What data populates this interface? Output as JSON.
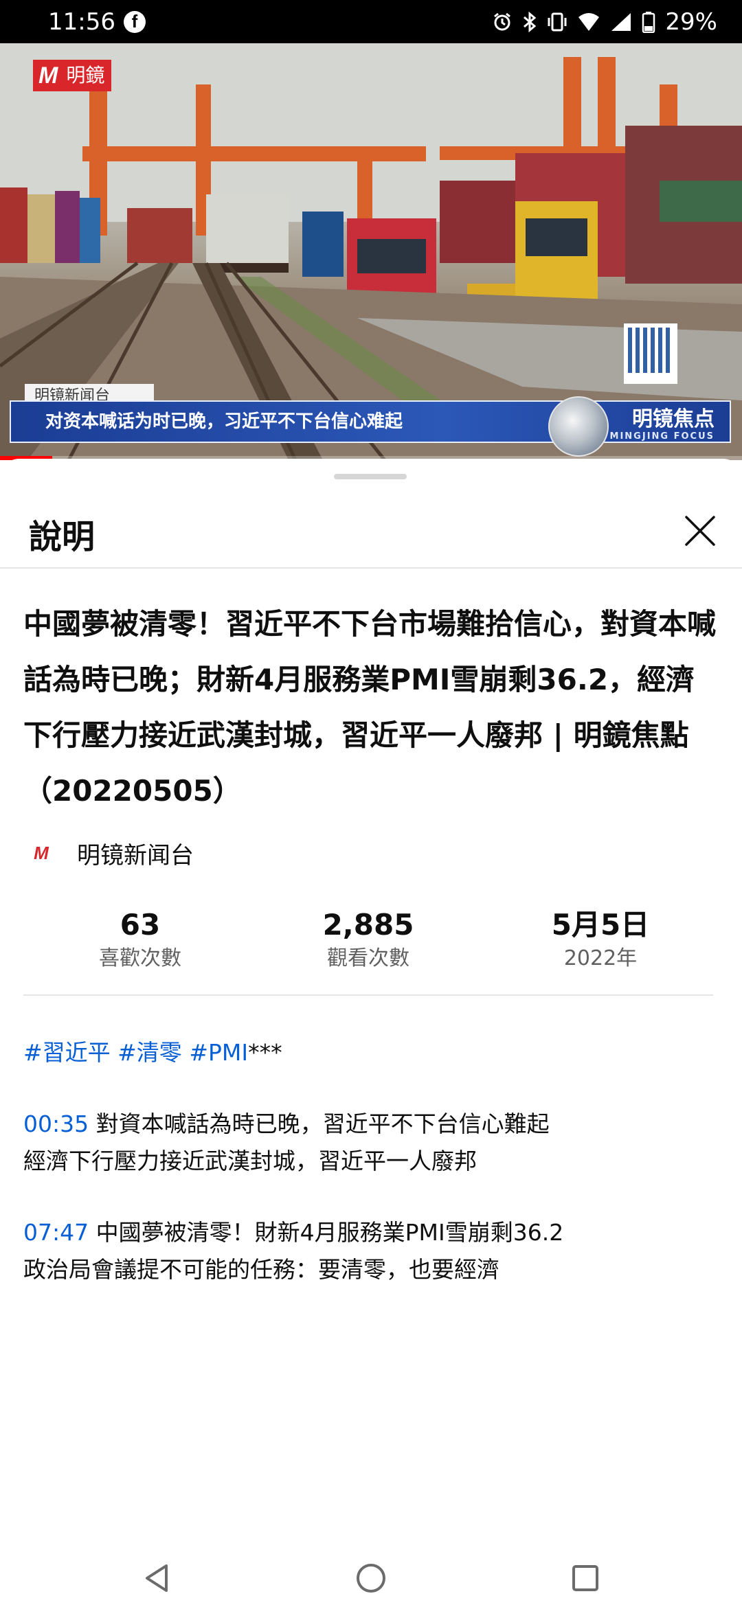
{
  "status_bar": {
    "time": "11:56",
    "notification_icon": "facebook-icon",
    "battery_percent": "29%",
    "icons": [
      "alarm-icon",
      "bluetooth-icon",
      "vibrate-icon",
      "wifi-icon",
      "signal-icon",
      "battery-icon"
    ]
  },
  "video": {
    "logo_mark": "M",
    "logo_text": "明鏡",
    "caption_small": "明镜新闻台",
    "caption_main": "对资本喊话为时已晚，习近平不下台信心难起",
    "caption_brand": "明镜焦点",
    "caption_brand_sub": "MINGJING FOCUS",
    "progress": 0.07
  },
  "panel": {
    "title": "說明",
    "video_title": "中國夢被清零！習近平不下台市場難拾信心，對資本喊話為時已晚；財新4月服務業PMI雪崩剩36.2，經濟下行壓力接近武漢封城，習近平一人廢邦 | 明鏡焦點（20220505）",
    "channel": {
      "logo": "M",
      "name": "明镜新闻台"
    },
    "stats": [
      {
        "value": "63",
        "label": "喜歡次數"
      },
      {
        "value": "2,885",
        "label": "觀看次數"
      },
      {
        "value": "5月5日",
        "label": "2022年"
      }
    ],
    "hashtags": [
      "#習近平",
      "#清零",
      "#PMI"
    ],
    "hashtags_suffix": "***",
    "chapters": [
      {
        "timestamp": "00:35",
        "line1": "對資本喊話為時已晚，習近平不下台信心難起",
        "line2": "經濟下行壓力接近武漢封城，習近平一人廢邦"
      },
      {
        "timestamp": "07:47",
        "line1": "中國夢被清零！財新4月服務業PMI雪崩剩36.2",
        "line2": "政治局會議提不可能的任務：要清零，也要經濟"
      }
    ]
  },
  "nav_bar": {
    "buttons": [
      "back-icon",
      "home-icon",
      "recents-icon"
    ]
  }
}
